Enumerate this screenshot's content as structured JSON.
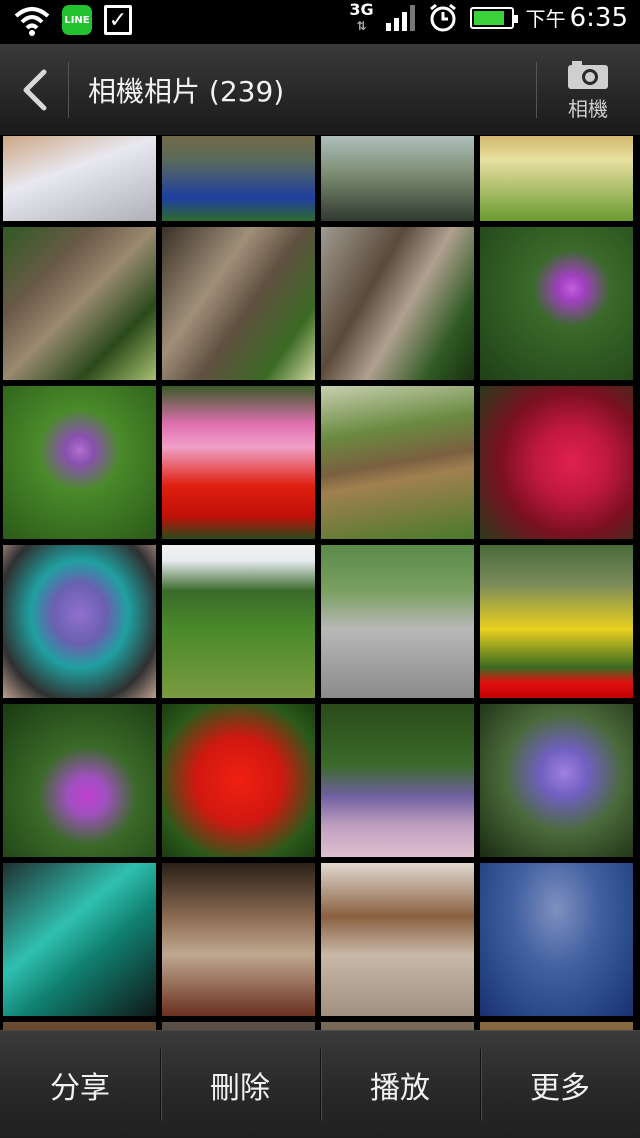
{
  "status_bar": {
    "line_label": "LINE",
    "network": "3G",
    "ampm": "下午",
    "time": "6:35",
    "battery_level": 0.85
  },
  "action_bar": {
    "title": "相機相片 (239)",
    "camera_label": "相機"
  },
  "bottom_bar": {
    "share": "分享",
    "delete": "刪除",
    "play": "播放",
    "more": "更多"
  },
  "colors": {
    "accent_green": "#22c32e"
  },
  "thumbnails": [
    {
      "name": "photo-people-table",
      "bg": "linear-gradient(160deg,#6b5a48 0%,#caa07a 30%,#e8e8f0 60%,#b0b0b8 100%)"
    },
    {
      "name": "photo-people-pavilion",
      "bg": "linear-gradient(180deg,#3b2a1a 0%,#8a6a3a 30%,#5a6a5a 60%,#1f3fa0 85%,#2d6a2d 100%)"
    },
    {
      "name": "photo-glass-table",
      "bg": "linear-gradient(180deg,#5a6060 0%,#b8c8c8 40%,#7a8a70 70%,#303a30 100%)"
    },
    {
      "name": "photo-restaurant-table",
      "bg": "linear-gradient(180deg,#4a3a28 0%,#c8a050 35%,#e8e0a0 60%,#6a9a30 100%)"
    },
    {
      "name": "photo-tree-trunk-1",
      "bg": "linear-gradient(135deg,#2f5a22 0%,#6a5a48 30%,#9a8a70 50%,#2a4a1a 75%,#a8c070 100%)"
    },
    {
      "name": "photo-tree-trunk-2",
      "bg": "linear-gradient(125deg,#3a3026 0%,#a0907a 35%,#605040 55%,#3b6a24 80%,#cfd8a0 100%)"
    },
    {
      "name": "photo-tree-trunk-3",
      "bg": "linear-gradient(120deg,#a09a90 0%,#5a4a3a 35%,#b0a090 55%,#2f5a22 80%,#1a3012 100%)"
    },
    {
      "name": "photo-pink-lily",
      "bg": "radial-gradient(circle at 60% 40%,#c060e0 0%,#a040c0 10%,#3a6a2a 30%,#1f4016 100%)"
    },
    {
      "name": "photo-purple-iris",
      "bg": "radial-gradient(circle at 50% 42%,#b070d0 0%,#8a50b0 12%,#4a8a2a 35%,#2a5a18 100%)"
    },
    {
      "name": "photo-red-pink-flowers",
      "bg": "linear-gradient(180deg,#3a5a28 0%,#e070b0 25%,#f0a0c8 40%,#e02010 65%,#c01008 85%,#2a4a1a 100%)"
    },
    {
      "name": "photo-trees-path",
      "bg": "linear-gradient(170deg,#c8d0b0 0%,#6a8a40 30%,#7a6040 50%,#a08050 60%,#4a7a2a 100%)"
    },
    {
      "name": "photo-red-azalea",
      "bg": "radial-gradient(circle at 60% 50%,#e02050 0%,#c01840 30%,#7a1020 60%,#2a3a1a 100%)"
    },
    {
      "name": "photo-owl-shirt",
      "bg": "radial-gradient(ellipse at 50% 45%,#9070d0 0%,#6a60b0 25%,#20a0a0 45%,#303030 75%,#c0a090 100%)"
    },
    {
      "name": "photo-park-lawn",
      "bg": "linear-gradient(180deg,#f0f0f0 0%,#e8ecf0 10%,#3a6a2a 30%,#4a8a2a 55%,#7a9a40 100%)"
    },
    {
      "name": "photo-parking-lot",
      "bg": "linear-gradient(180deg,#5a8a4a 0%,#7aa060 30%,#b8b8b8 55%,#8a8a8a 100%)"
    },
    {
      "name": "photo-yellow-daisies",
      "bg": "linear-gradient(180deg,#4a6a3a 0%,#7a8a5a 25%,#e8d020 55%,#3a6a20 80%,#e01010 90%,#c00000 100%)"
    },
    {
      "name": "photo-purple-flowers-leaves",
      "bg": "radial-gradient(circle at 55% 60%,#c040d0 0%,#a050c0 15%,#3a6a28 40%,#1a3a12 100%)"
    },
    {
      "name": "photo-red-impatiens",
      "bg": "radial-gradient(circle at 50% 50%,#f02010 0%,#d01810 40%,#2a5a1a 75%,#1a3a10 100%)"
    },
    {
      "name": "photo-purple-orchid-bush",
      "bg": "linear-gradient(180deg,#2a4a1a 0%,#3a6a2a 40%,#7060a0 60%,#c0a0c0 80%,#e0c0d0 100%)"
    },
    {
      "name": "photo-purple-orchids",
      "bg": "radial-gradient(circle at 55% 45%,#a080e0 0%,#7060c0 20%,#4a6a3a 50%,#1a2a12 100%)"
    },
    {
      "name": "photo-green-lights-mall",
      "bg": "linear-gradient(140deg,#203030 0%,#30c0b0 40%,#108070 60%,#101818 100%)"
    },
    {
      "name": "photo-hotel-lobby-1",
      "bg": "linear-gradient(180deg,#2a2018 0%,#8a6a50 35%,#c0a890 60%,#6a3020 100%)"
    },
    {
      "name": "photo-hotel-lobby-2",
      "bg": "linear-gradient(180deg,#e0d8d0 0%,#8a6040 35%,#c8b8a8 60%,#a09080 100%)"
    },
    {
      "name": "photo-blue-tiles",
      "bg": "radial-gradient(ellipse at 50% 30%,#8090c0 0%,#4060a0 40%,#2a4a8a 70%,#1a3070 100%)"
    },
    {
      "name": "photo-partial-1",
      "bg": "linear-gradient(180deg,#6a4a30 0%,#3a2a1a 100%)"
    },
    {
      "name": "photo-partial-2",
      "bg": "linear-gradient(180deg,#5a5048 0%,#3a3028 100%)"
    },
    {
      "name": "photo-partial-3",
      "bg": "linear-gradient(180deg,#7a6a58 0%,#3a3028 100%)"
    },
    {
      "name": "photo-partial-4",
      "bg": "linear-gradient(180deg,#8a6a40 0%,#4a3018 100%)"
    }
  ]
}
